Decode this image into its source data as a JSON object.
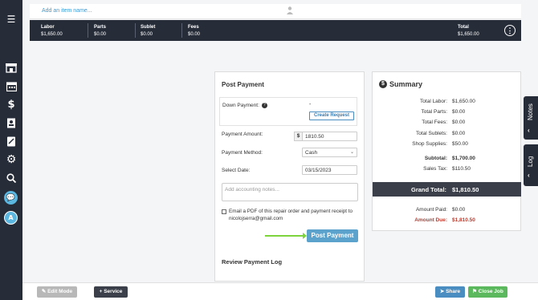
{
  "item_row": {
    "placeholder": "Add an item name..."
  },
  "totals": {
    "labor_label": "Labor",
    "labor_value": "$1,650.00",
    "parts_label": "Parts",
    "parts_value": "$0.00",
    "sublet_label": "Sublet",
    "sublet_value": "$0.00",
    "fees_label": "Fees",
    "fees_value": "$0.00",
    "total_label": "Total",
    "total_value": "$1,650.00"
  },
  "post_payment": {
    "title": "Post Payment",
    "down_payment_label": "Down Payment:",
    "down_payment_value": "-",
    "create_request_label": "Create Request",
    "amount_label": "Payment Amount:",
    "currency_symbol": "$",
    "amount_value": "1810.50",
    "method_label": "Payment Method:",
    "method_value": "Cash",
    "date_label": "Select Date:",
    "date_value": "03/15/2023",
    "notes_placeholder": "Add accounting notes...",
    "email_text": "Email a PDF of this repair order and payment receipt to nicolojserra@gmail.com",
    "post_button_label": "Post Payment",
    "review_title": "Review Payment Log"
  },
  "summary": {
    "title": "Summary",
    "rows": [
      {
        "label": "Total Labor:",
        "value": "$1,650.00"
      },
      {
        "label": "Total Parts:",
        "value": "$0.00"
      },
      {
        "label": "Total Fees:",
        "value": "$0.00"
      },
      {
        "label": "Total Sublets:",
        "value": "$0.00"
      },
      {
        "label": "Shop Supplies:",
        "value": "$50.00"
      },
      {
        "label": "Subtotal:",
        "value": "$1,700.00"
      },
      {
        "label": "Sales Tax:",
        "value": "$110.50"
      }
    ],
    "grand_total_label": "Grand Total:",
    "grand_total_value": "$1,810.50",
    "amount_paid_label": "Amount Paid:",
    "amount_paid_value": "$0.00",
    "amount_due_label": "Amount Due:",
    "amount_due_value": "$1,810.50"
  },
  "side_tabs": {
    "notes_label": "Notes",
    "log_label": "Log"
  },
  "bottom_bar": {
    "edit_mode_label": "Edit Mode",
    "service_label": "+ Service",
    "share_label": "Share",
    "close_job_label": "Close Job"
  },
  "sidebar": {
    "avatar_initial": "A"
  },
  "colors": {
    "accent": "#5ba2cc",
    "dark": "#262c38",
    "success": "#5cb85c",
    "due": "#c0392b"
  }
}
